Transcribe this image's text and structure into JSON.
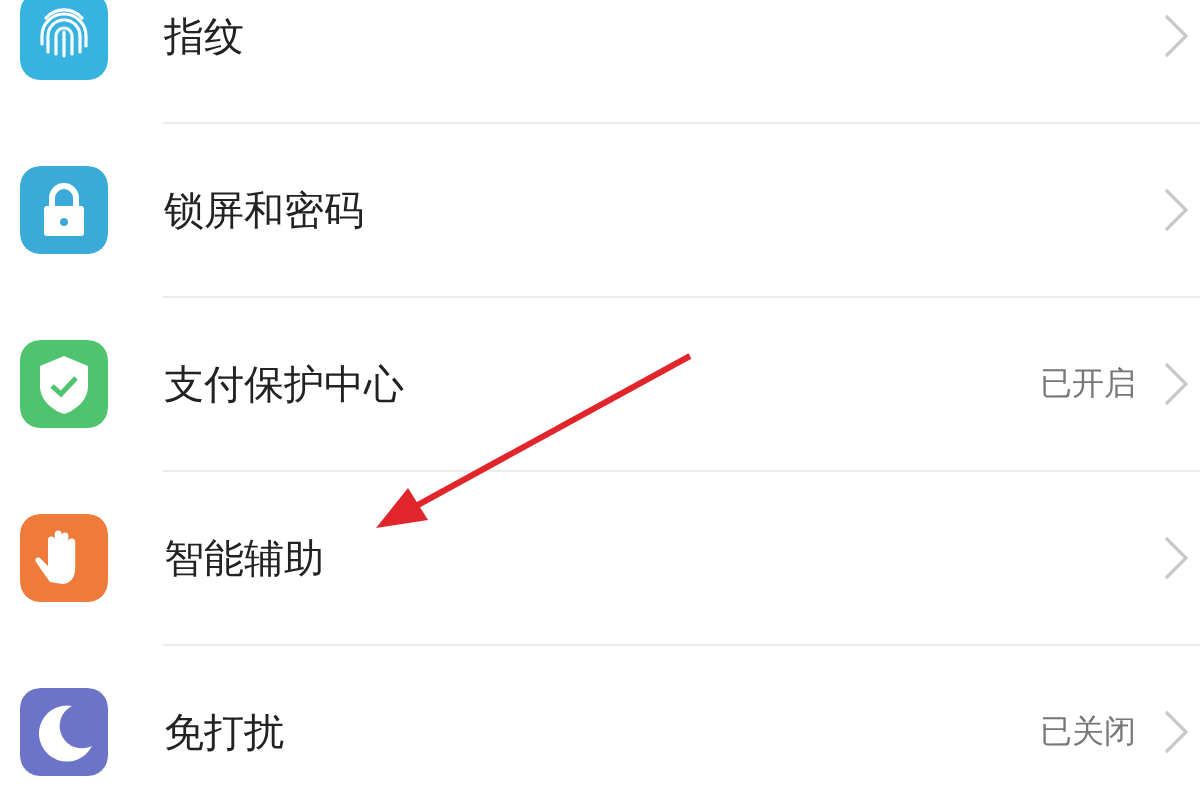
{
  "settings": [
    {
      "label": "指纹"
    },
    {
      "label": "锁屏和密码"
    },
    {
      "label": "支付保护中心",
      "value": "已开启"
    },
    {
      "label": "智能辅助"
    },
    {
      "label": "免打扰",
      "value": "已关闭"
    }
  ]
}
